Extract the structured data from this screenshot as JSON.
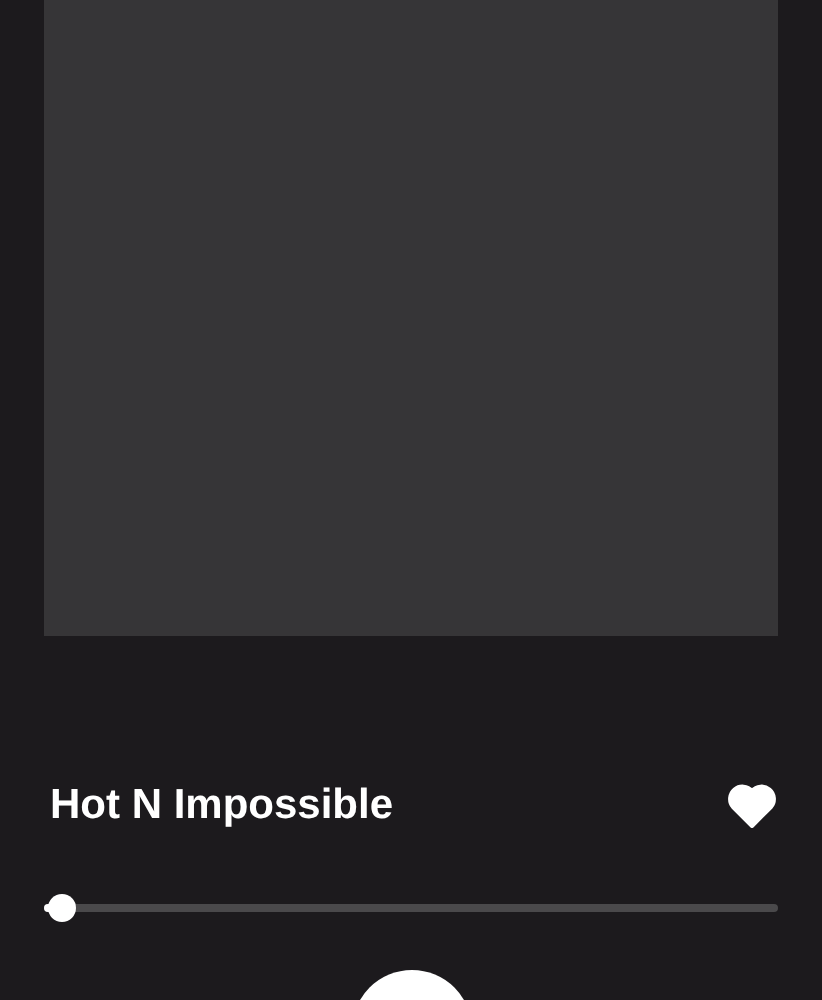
{
  "track": {
    "title": "Hot N Impossible",
    "liked": true
  },
  "progress": {
    "level": 0.02
  }
}
